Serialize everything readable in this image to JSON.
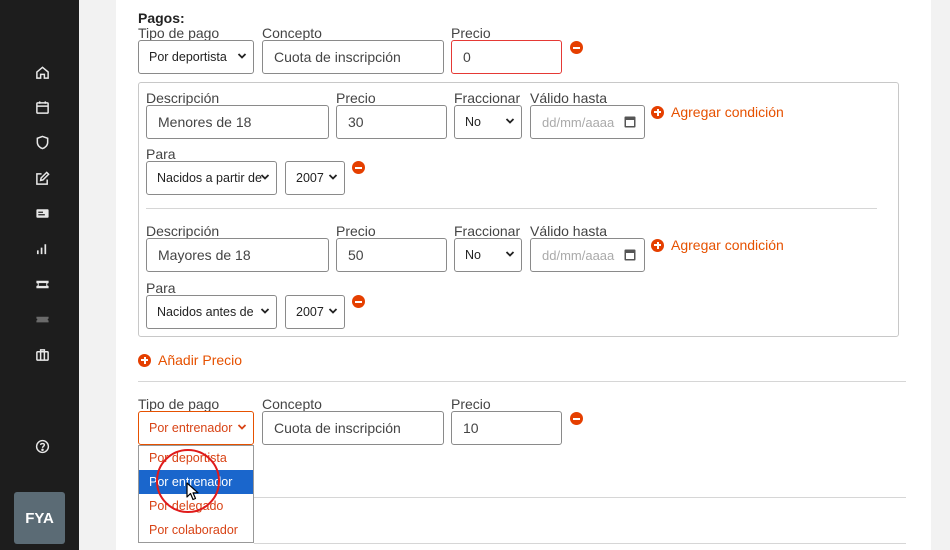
{
  "sidebar": {
    "icons": [
      "home-icon",
      "calendar-icon",
      "shield-icon",
      "edit-icon",
      "id-card-icon",
      "chart-bar-icon",
      "ticket-icon",
      "ticket-disabled-icon",
      "briefcase-icon",
      "help-icon"
    ],
    "avatar": "FYA"
  },
  "pagos": {
    "title": "Pagos:",
    "labels": {
      "tipo": "Tipo de pago",
      "concepto": "Concepto",
      "precio": "Precio"
    },
    "row1": {
      "tipo": "Por deportista",
      "concepto": "Cuota de inscripción",
      "precio": "0"
    },
    "conditions_labels": {
      "descripcion": "Descripción",
      "precio": "Precio",
      "fraccionar": "Fraccionar",
      "valido": "Válido hasta",
      "para": "Para"
    },
    "conditions": [
      {
        "descripcion": "Menores de 18",
        "precio": "30",
        "fraccionar": "No",
        "valido_placeholder": "dd/mm/aaaa",
        "para": "Nacidos a partir de",
        "year": "2007"
      },
      {
        "descripcion": "Mayores de 18",
        "precio": "50",
        "fraccionar": "No",
        "valido_placeholder": "dd/mm/aaaa",
        "para": "Nacidos antes de",
        "year": "2007"
      }
    ],
    "agregar_condicion": "Agregar condición",
    "anadir_precio": "Añadir Precio",
    "row2": {
      "tipo": "Por entrenador",
      "concepto": "Cuota de inscripción",
      "precio": "10"
    },
    "dropdown_options": [
      "Por deportista",
      "Por entrenador",
      "Por delegado",
      "Por colaborador"
    ],
    "dropdown_selected_index": 1
  },
  "colors": {
    "accent": "#e53f00",
    "error_border": "#e53935",
    "selected_option": "#1a66cc"
  }
}
